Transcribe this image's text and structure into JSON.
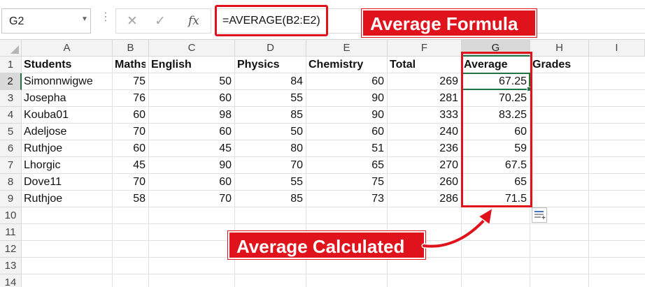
{
  "formula_bar": {
    "name_box": "G2",
    "cancel_icon": "cancel-x-icon",
    "enter_icon": "check-icon",
    "fx_label": "fx",
    "formula": "=AVERAGE(B2:E2)"
  },
  "columns": [
    "A",
    "B",
    "C",
    "D",
    "E",
    "F",
    "G",
    "H",
    "I"
  ],
  "rows": [
    "1",
    "2",
    "3",
    "4",
    "5",
    "6",
    "7",
    "8",
    "9",
    "10",
    "11",
    "12",
    "13",
    "14"
  ],
  "table": {
    "headers": [
      "Students",
      "Maths",
      "English",
      "Physics",
      "Chemistry",
      "Total",
      "Average",
      "Grades"
    ],
    "data": [
      [
        "Simonnwigwe",
        "75",
        "50",
        "84",
        "60",
        "269",
        "67.25"
      ],
      [
        "Josepha",
        "76",
        "60",
        "55",
        "90",
        "281",
        "70.25"
      ],
      [
        "Kouba01",
        "60",
        "98",
        "85",
        "90",
        "333",
        "83.25"
      ],
      [
        "Adeljose",
        "70",
        "60",
        "50",
        "60",
        "240",
        "60"
      ],
      [
        "Ruthjoe",
        "60",
        "45",
        "80",
        "51",
        "236",
        "59"
      ],
      [
        "Lhorgic",
        "45",
        "90",
        "70",
        "65",
        "270",
        "67.5"
      ],
      [
        "Dove11",
        "70",
        "60",
        "55",
        "75",
        "260",
        "65"
      ],
      [
        "Ruthjoe",
        "58",
        "70",
        "85",
        "73",
        "286",
        "71.5"
      ]
    ]
  },
  "selection": {
    "active_cell": "G2"
  },
  "annotations": {
    "top_label": "Average Formula",
    "bottom_label": "Average Calculated"
  },
  "colors": {
    "accent": "#217346",
    "annotation_red": "#e0121b"
  }
}
